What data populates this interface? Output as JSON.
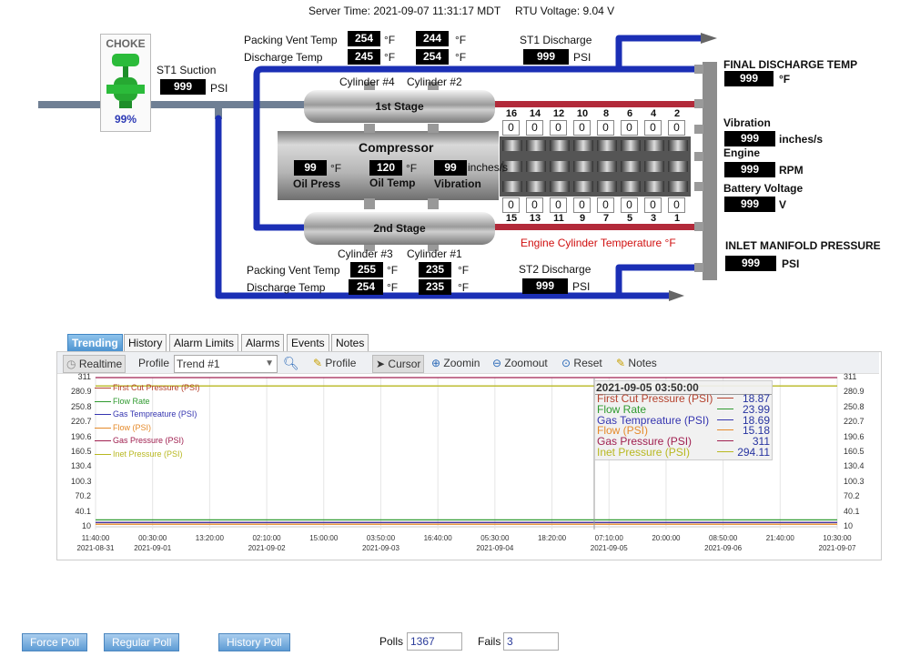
{
  "header": {
    "server_time": "Server Time: 2021-09-07 11:31:17 MDT",
    "rtu_voltage": "RTU Voltage: 9.04 V"
  },
  "choke": {
    "title": "CHOKE",
    "pct": "99%"
  },
  "st1_suction": {
    "label": "ST1 Suction",
    "value": "999",
    "unit": "PSI"
  },
  "top": {
    "packing_vent_label": "Packing Vent Temp",
    "discharge_label": "Discharge Temp",
    "pv1": "254",
    "pv2": "244",
    "dt1": "245",
    "dt2": "254",
    "unit": "°F",
    "cyl_a": "Cylinder #4",
    "cyl_b": "Cylinder #2",
    "stage": "1st Stage"
  },
  "st1_discharge": {
    "label": "ST1 Discharge",
    "value": "999",
    "unit": "PSI"
  },
  "compressor": {
    "title": "Compressor",
    "oil_press_value": "99",
    "oil_press_unit": "°F",
    "oil_press_label": "Oil Press",
    "oil_temp_value": "120",
    "oil_temp_unit": "°F",
    "oil_temp_label": "Oil Temp",
    "vibration_value": "99",
    "vibration_unit": "inches/s",
    "vibration_label": "Vibration"
  },
  "engine_top": {
    "nums": [
      "16",
      "14",
      "12",
      "10",
      "8",
      "6",
      "4",
      "2"
    ],
    "vals": [
      "0",
      "0",
      "0",
      "0",
      "0",
      "0",
      "0",
      "0"
    ]
  },
  "engine_bottom": {
    "nums": [
      "15",
      "13",
      "11",
      "9",
      "7",
      "5",
      "3",
      "1"
    ],
    "vals": [
      "0",
      "0",
      "0",
      "0",
      "0",
      "0",
      "0",
      "0"
    ]
  },
  "engine_caption": "Engine Cylinder Temperature °F",
  "bottom": {
    "cyl_a": "Cylinder #3",
    "cyl_b": "Cylinder #1",
    "stage": "2nd Stage",
    "packing_vent_label": "Packing Vent Temp",
    "discharge_label": "Discharge Temp",
    "pv1": "255",
    "pv2": "235",
    "dt1": "254",
    "dt2": "235",
    "unit": "°F"
  },
  "st2_discharge": {
    "label": "ST2 Discharge",
    "value": "999",
    "unit": "PSI"
  },
  "right": {
    "final_label": "FINAL DISCHARGE TEMP",
    "final_value": "999",
    "final_unit": "°F",
    "vib_label": "Vibration",
    "vib_value": "999",
    "vib_unit": "inches/s",
    "engine_label": "Engine",
    "engine_value": "999",
    "engine_unit": "RPM",
    "batt_label": "Battery Voltage",
    "batt_value": "999",
    "batt_unit": "V",
    "inlet_label": "INLET MANIFOLD PRESSURE",
    "inlet_value": "999",
    "inlet_unit": "PSI"
  },
  "tabs": [
    "Trending",
    "History",
    "Alarm Limits",
    "Alarms",
    "Events",
    "Notes"
  ],
  "toolbar": {
    "realtime": "Realtime",
    "profile_label": "Profile",
    "profile_value": "Trend #1",
    "profile_btn": "Profile",
    "cursor": "Cursor",
    "zoomin": "Zoomin",
    "zoomout": "Zoomout",
    "reset": "Reset",
    "notes": "Notes"
  },
  "chart_data": {
    "type": "line",
    "yticks": [
      "311",
      "280.9",
      "250.8",
      "220.7",
      "190.6",
      "160.5",
      "130.4",
      "100.3",
      "70.2",
      "40.1",
      "10"
    ],
    "ylim": [
      10,
      311
    ],
    "xticks": [
      {
        "t": "11:40:00",
        "d": "2021-08-31"
      },
      {
        "t": "00:30:00",
        "d": "2021-09-01"
      },
      {
        "t": "13:20:00",
        "d": ""
      },
      {
        "t": "02:10:00",
        "d": "2021-09-02"
      },
      {
        "t": "15:00:00",
        "d": ""
      },
      {
        "t": "03:50:00",
        "d": "2021-09-03"
      },
      {
        "t": "16:40:00",
        "d": ""
      },
      {
        "t": "05:30:00",
        "d": "2021-09-04"
      },
      {
        "t": "18:20:00",
        "d": ""
      },
      {
        "t": "07:10:00",
        "d": "2021-09-05"
      },
      {
        "t": "20:00:00",
        "d": ""
      },
      {
        "t": "08:50:00",
        "d": "2021-09-06"
      },
      {
        "t": "21:40:00",
        "d": ""
      },
      {
        "t": "10:30:00",
        "d": "2021-09-07"
      }
    ],
    "series": [
      {
        "name": "First Cut Pressure (PSI)",
        "color": "#b5422e",
        "value": 18.87
      },
      {
        "name": "Flow Rate",
        "color": "#2f9a2f",
        "value": 23.99
      },
      {
        "name": "Gas Tempreature (PSI)",
        "color": "#3535b0",
        "value": 18.69
      },
      {
        "name": "Flow (PSI)",
        "color": "#e58a2a",
        "value": 15.18
      },
      {
        "name": "Gas Pressure (PSI)",
        "color": "#a02050",
        "value": 311
      },
      {
        "name": "Inet Pressure (PSI)",
        "color": "#b8b820",
        "value": 294.11
      }
    ],
    "cursor": {
      "time": "2021-09-05 03:50:00",
      "values": [
        "18.87",
        "23.99",
        "18.69",
        "15.18",
        "311",
        "294.11"
      ]
    }
  },
  "footer": {
    "force_poll": "Force Poll",
    "regular_poll": "Regular Poll",
    "history_poll": "History Poll",
    "polls_label": "Polls",
    "polls_value": "1367",
    "fails_label": "Fails",
    "fails_value": "3"
  }
}
